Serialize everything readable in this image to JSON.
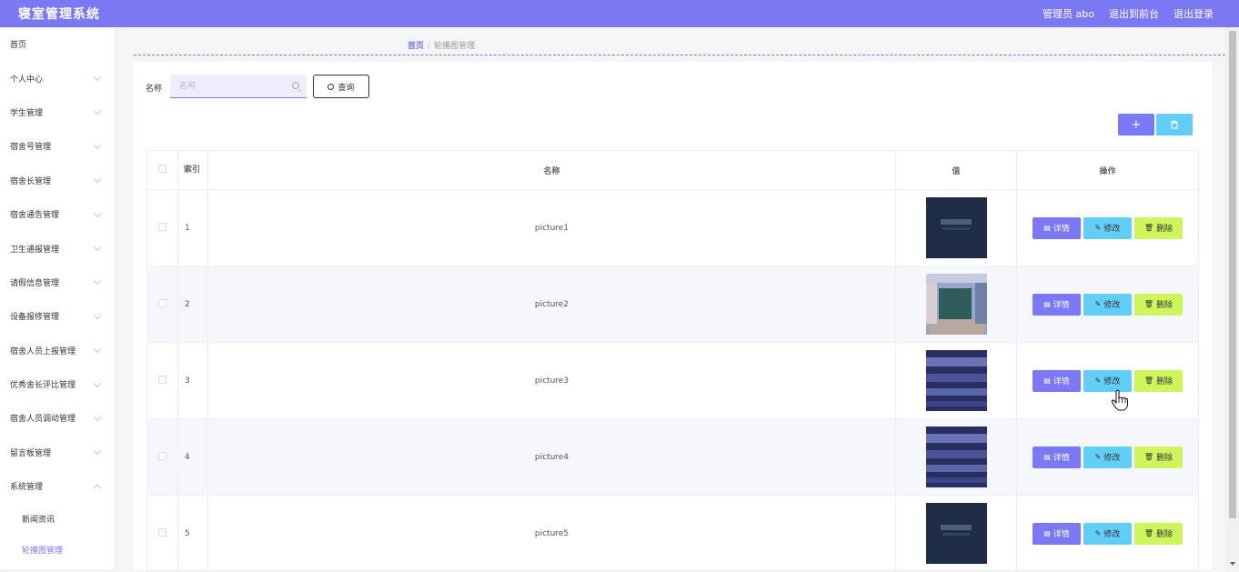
{
  "header": {
    "app_title": "寝室管理系统",
    "user": "管理员 abo",
    "to_front": "退出到前台",
    "logout": "退出登录"
  },
  "sidebar": {
    "items": [
      {
        "label": "首页",
        "expandable": false
      },
      {
        "label": "个人中心",
        "expandable": true
      },
      {
        "label": "学生管理",
        "expandable": true
      },
      {
        "label": "宿舍号管理",
        "expandable": true
      },
      {
        "label": "宿舍长管理",
        "expandable": true
      },
      {
        "label": "宿舍通告管理",
        "expandable": true
      },
      {
        "label": "卫生通报管理",
        "expandable": true
      },
      {
        "label": "请假信息管理",
        "expandable": true
      },
      {
        "label": "设备报修管理",
        "expandable": true
      },
      {
        "label": "宿舍人员上报管理",
        "expandable": true
      },
      {
        "label": "优秀舍长评比管理",
        "expandable": true
      },
      {
        "label": "宿舍人员调动管理",
        "expandable": true
      },
      {
        "label": "留言板管理",
        "expandable": true
      },
      {
        "label": "系统管理",
        "expandable": true,
        "expanded": true
      }
    ],
    "sub_items": [
      {
        "label": "新闻资讯",
        "active": false
      },
      {
        "label": "轮播图管理",
        "active": true
      }
    ]
  },
  "breadcrumb": {
    "home": "首页",
    "separator": "/",
    "current": "轮播图管理"
  },
  "search": {
    "label": "名称",
    "placeholder": "名称",
    "value": "",
    "button": "查询"
  },
  "toolbar": {
    "add_icon": "plus-icon",
    "delete_icon": "trash-icon"
  },
  "table": {
    "headers": {
      "index": "索引",
      "name": "名称",
      "value": "值",
      "actions": "操作"
    },
    "rows": [
      {
        "index": "1",
        "name": "picture1",
        "image": "dark-navy-banner"
      },
      {
        "index": "2",
        "name": "picture2",
        "image": "classroom-photo"
      },
      {
        "index": "3",
        "name": "picture3",
        "image": "crowd-photo"
      },
      {
        "index": "4",
        "name": "picture4",
        "image": "crowd-photo"
      },
      {
        "index": "5",
        "name": "picture5",
        "image": "dark-navy-banner"
      }
    ],
    "actions": {
      "detail": "详情",
      "edit": "修改",
      "delete": "删除"
    }
  },
  "colors": {
    "primary": "#7b78f4",
    "edit": "#62cdf6",
    "delete": "#cff55c"
  }
}
